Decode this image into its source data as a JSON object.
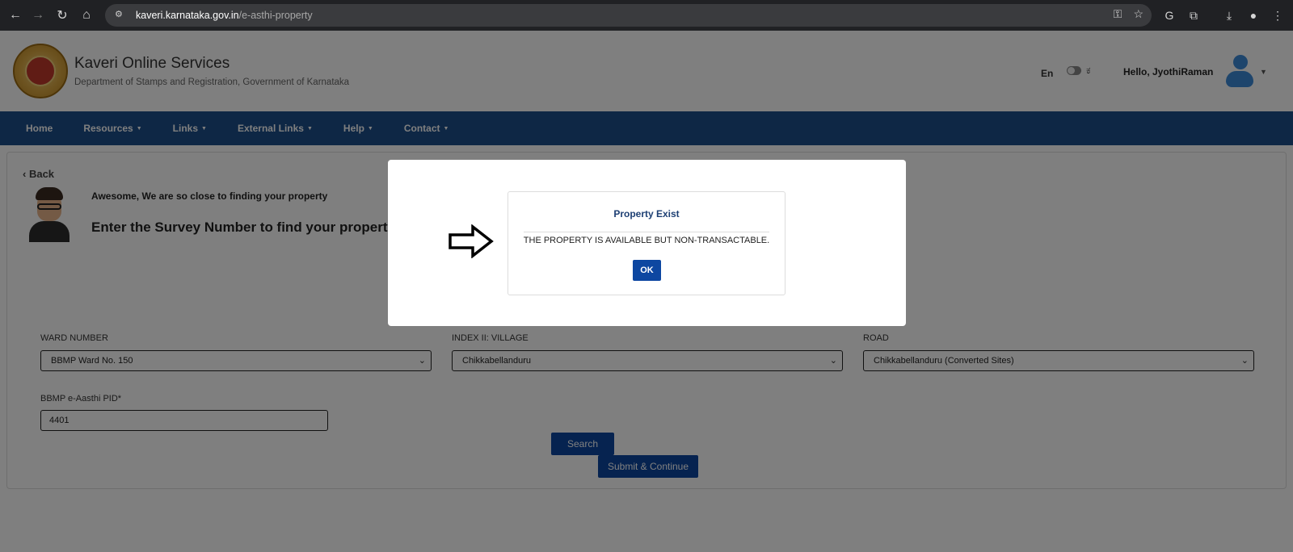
{
  "browser": {
    "url_host": "kaveri.karnataka.gov.in",
    "url_path": "/e-asthi-property"
  },
  "header": {
    "title": "Kaveri Online Services",
    "subtitle": "Department of Stamps and Registration, Government of Karnataka",
    "lang_en": "En",
    "lang_kn": "ಕ",
    "greeting": "Hello, JyothiRaman"
  },
  "nav": {
    "items": [
      {
        "label": "Home"
      },
      {
        "label": "Resources"
      },
      {
        "label": "Links"
      },
      {
        "label": "External Links"
      },
      {
        "label": "Help"
      },
      {
        "label": "Contact"
      }
    ]
  },
  "main": {
    "back_label": "Back",
    "awesome_text": "Awesome, We are so close to finding your property",
    "enter_text": "Enter the Survey Number to find your property",
    "ward_label": "WARD NUMBER",
    "ward_value": "BBMP Ward No. 150",
    "village_label": "INDEX II: VILLAGE",
    "village_value": "Chikkabellanduru",
    "road_label": "ROAD",
    "road_value": "Chikkabellanduru (Converted Sites)",
    "pid_label": "BBMP e-Aasthi PID*",
    "pid_value": "4401",
    "search_label": "Search",
    "submit_label": "Submit & Continue"
  },
  "modal": {
    "title": "Property Exist",
    "message": "THE PROPERTY IS AVAILABLE BUT NON-TRANSACTABLE.",
    "ok_label": "OK"
  }
}
